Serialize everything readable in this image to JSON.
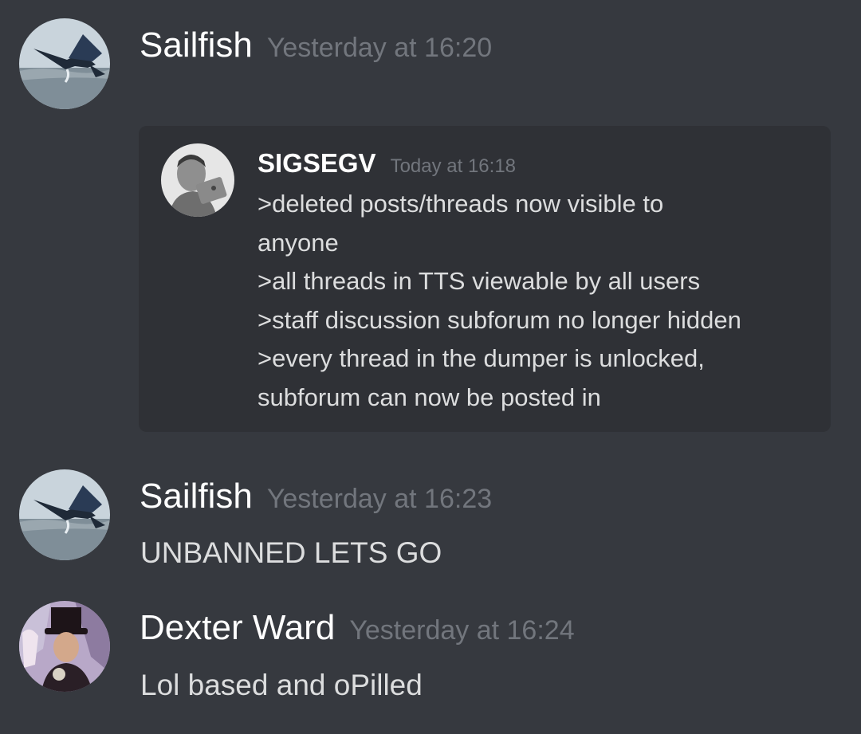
{
  "messages": [
    {
      "author": "Sailfish",
      "timestamp": "Yesterday at 16:20",
      "avatar": "sailfish-avatar",
      "embed": {
        "author": "SIGSEGV",
        "timestamp": "Today at 16:18",
        "avatar": "man-with-laptop-avatar",
        "lines": [
          ">deleted posts/threads now visible to",
          "anyone",
          ">all threads in TTS viewable by all users",
          ">staff discussion subforum no longer hidden",
          ">every thread in the dumper is unlocked,",
          "subforum can now be posted in"
        ]
      }
    },
    {
      "author": "Sailfish",
      "timestamp": "Yesterday at 16:23",
      "avatar": "sailfish-avatar",
      "content": "UNBANNED LETS GO"
    },
    {
      "author": "Dexter Ward",
      "timestamp": "Yesterday at 16:24",
      "avatar": "top-hat-man-avatar",
      "content": "Lol based and oPilled"
    }
  ],
  "colors": {
    "background": "#36393f",
    "embed_background": "#2f3136",
    "username": "#ffffff",
    "timestamp": "#72767d",
    "text": "#dcddde"
  }
}
